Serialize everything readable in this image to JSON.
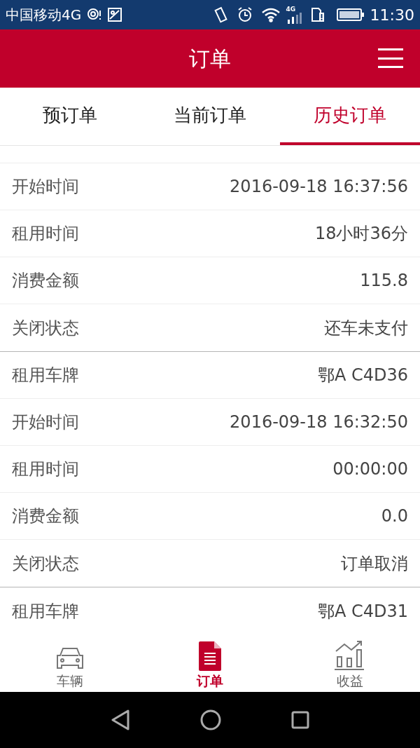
{
  "status_bar": {
    "carrier": "中国移动4G",
    "network": "4G",
    "time": "11:30"
  },
  "header": {
    "title": "订单"
  },
  "tabs": [
    {
      "label": "预订单",
      "selected": false
    },
    {
      "label": "当前订单",
      "selected": false
    },
    {
      "label": "历史订单",
      "selected": true
    }
  ],
  "orders": [
    {
      "fields": [
        {
          "label": "开始时间",
          "value": "2016-09-18 16:37:56"
        },
        {
          "label": "租用时间",
          "value": "18小时36分"
        },
        {
          "label": "消费金额",
          "value": "115.8"
        },
        {
          "label": "关闭状态",
          "value": "还车未支付"
        }
      ]
    },
    {
      "fields": [
        {
          "label": "租用车牌",
          "value": "鄂A C4D36"
        },
        {
          "label": "开始时间",
          "value": "2016-09-18 16:32:50"
        },
        {
          "label": "租用时间",
          "value": "00:00:00"
        },
        {
          "label": "消费金额",
          "value": "0.0"
        },
        {
          "label": "关闭状态",
          "value": "订单取消"
        }
      ]
    },
    {
      "fields": [
        {
          "label": "租用车牌",
          "value": "鄂A C4D31"
        }
      ]
    }
  ],
  "bottom_nav": [
    {
      "kind": "car",
      "label": "车辆",
      "selected": false
    },
    {
      "kind": "document",
      "label": "订单",
      "selected": true
    },
    {
      "kind": "chart",
      "label": "收益",
      "selected": false
    }
  ]
}
